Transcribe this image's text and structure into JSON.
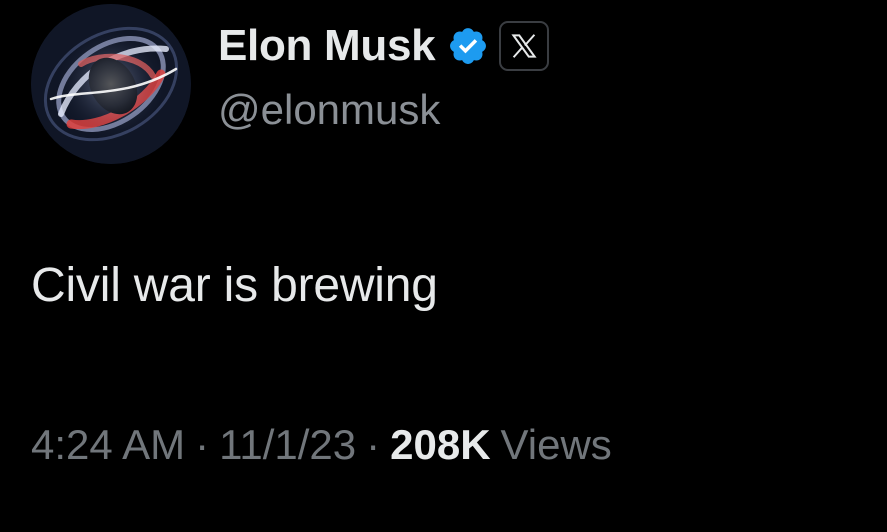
{
  "tweet": {
    "author": {
      "display_name": "Elon Musk",
      "handle": "@elonmusk",
      "verified": true,
      "verified_color": "#1d9bf0",
      "avatar_icon": "black-hole-avatar",
      "affiliation_icon": "x-logo-icon"
    },
    "text": "Civil war is brewing",
    "meta": {
      "time": "4:24 AM",
      "date": "11/1/23",
      "separator": "·",
      "views_count": "208K",
      "views_label": "Views"
    }
  },
  "colors": {
    "background": "#000000",
    "primary_text": "#e7e9ea",
    "secondary_text": "#71767b",
    "verified_blue": "#1d9bf0"
  }
}
